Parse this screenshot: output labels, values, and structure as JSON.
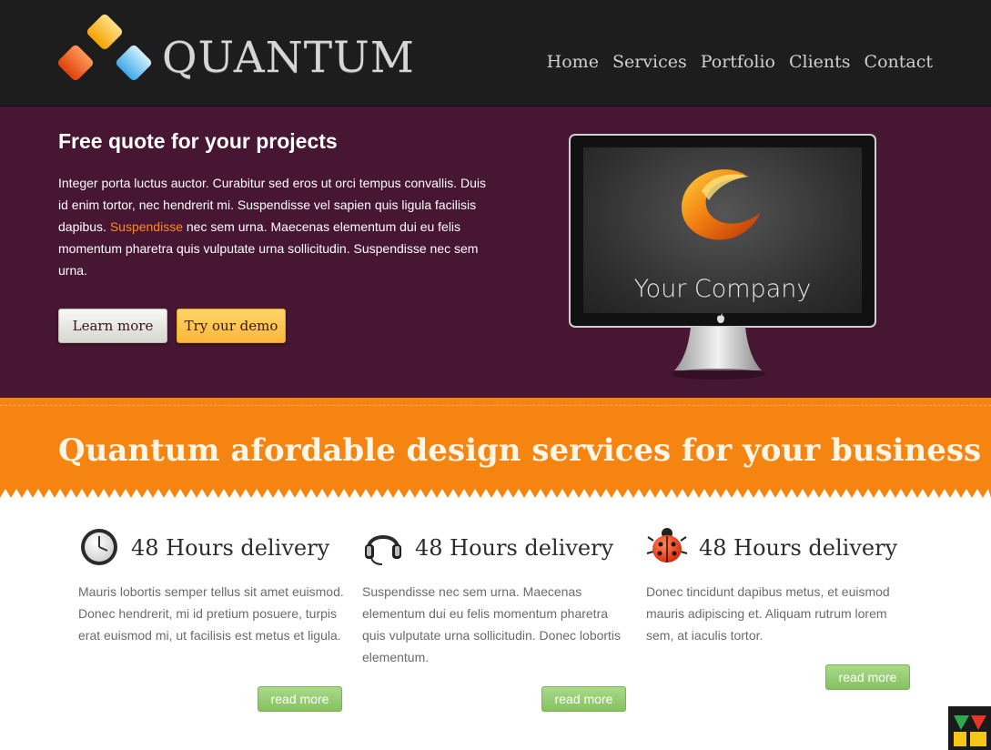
{
  "header": {
    "logo_text": "QUANTUM",
    "nav": [
      "Home",
      "Services",
      "Portfolio",
      "Clients",
      "Contact"
    ]
  },
  "hero": {
    "title": "Free quote for your projects",
    "text_before": "Integer porta luctus auctor. Curabitur sed eros ut orci tempus convallis. Duis id enim tortor, nec hendrerit mi. Suspendisse vel sapien quis ligula facilisis dapibus. ",
    "text_link": "Suspendisse",
    "text_after": " nec sem urna. Maecenas elementum dui eu felis momentum pharetra quis vulputate urna sollicitudin. Suspendisse nec sem urna.",
    "learn_more": "Learn more",
    "try_demo": "Try our demo",
    "monitor_text": "Your Company"
  },
  "banner": {
    "title": "Quantum afordable design services for your business"
  },
  "features": [
    {
      "icon": "clock-icon",
      "title": "48 Hours delivery",
      "text": "Mauris lobortis semper tellus sit amet euismod. Donec hendrerit, mi id pretium posuere, turpis erat euismod mi, ut facilisis est metus et ligula.",
      "button": "read more"
    },
    {
      "icon": "headset-icon",
      "title": "48 Hours delivery",
      "text": "Suspendisse nec sem urna. Maecenas elementum dui eu felis momentum pharetra quis vulputate urna sollicitudin. Donec lobortis elementum.",
      "button": "read more"
    },
    {
      "icon": "ladybug-icon",
      "title": "48 Hours delivery",
      "text": "Donec tincidunt dapibus metus, et euismod mauris adipiscing et. Aliquam rutrum lorem sem, at iaculis tortor.",
      "button": "read more"
    }
  ],
  "colors": {
    "header_bg": "#1d1d1d",
    "hero_bg": "#471633",
    "banner_bg": "#f58411",
    "link_accent": "#ff8a1f",
    "read_more_green": "#8fc96a"
  }
}
